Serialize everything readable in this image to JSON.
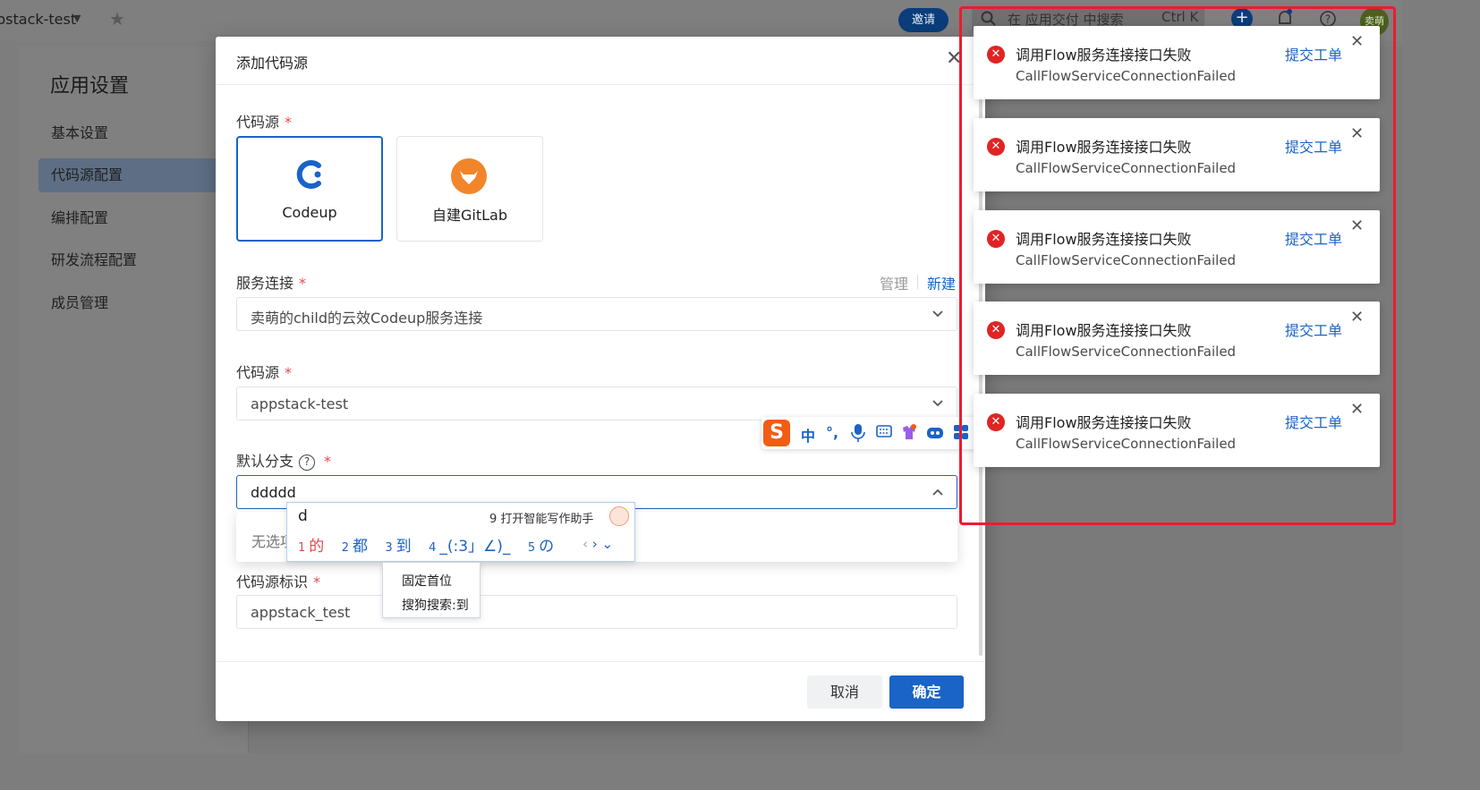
{
  "topbar": {
    "app_name": "pstack-test",
    "invite_label": "邀请",
    "search_placeholder": "在 应用交付 中搜索",
    "shortcut": "Ctrl K",
    "avatar_text": "卖萌"
  },
  "sidebar": {
    "title": "应用设置",
    "items": [
      {
        "label": "基本设置"
      },
      {
        "label": "代码源配置",
        "active": true
      },
      {
        "label": "编排配置"
      },
      {
        "label": "研发流程配置"
      },
      {
        "label": "成员管理"
      }
    ]
  },
  "modal": {
    "title": "添加代码源",
    "source_label": "代码源",
    "sources": [
      {
        "name": "Codeup",
        "selected": true
      },
      {
        "name": "自建GitLab",
        "selected": false
      }
    ],
    "service_label": "服务连接",
    "manage_link": "管理",
    "new_link": "新建",
    "service_value": "卖萌的child的云效Codeup服务连接",
    "repo_label": "代码源",
    "repo_value": "appstack-test",
    "branch_label": "默认分支",
    "branch_value": "ddddd",
    "dropdown_empty": "无选项",
    "identifier_label": "代码源标识",
    "identifier_value": "appstack_test",
    "required_mark": "*",
    "cancel_label": "取消",
    "ok_label": "确定"
  },
  "ime": {
    "typed": "d",
    "ai_hint": "9 打开智能写作助手",
    "candidates": [
      {
        "n": "1",
        "text": "的"
      },
      {
        "n": "2",
        "text": "都"
      },
      {
        "n": "3",
        "text": "到"
      },
      {
        "n": "4",
        "text": "_(:3」∠)_"
      },
      {
        "n": "5",
        "text": "の"
      }
    ],
    "menu": [
      "固定首位",
      "搜狗搜索:到"
    ],
    "toolbar_mode": "中",
    "toolbar_punct": "°,"
  },
  "notifications": [
    {
      "title": "调用Flow服务连接接口失败",
      "message": "CallFlowServiceConnectionFailed",
      "action": "提交工单"
    },
    {
      "title": "调用Flow服务连接接口失败",
      "message": "CallFlowServiceConnectionFailed",
      "action": "提交工单"
    },
    {
      "title": "调用Flow服务连接接口失败",
      "message": "CallFlowServiceConnectionFailed",
      "action": "提交工单"
    },
    {
      "title": "调用Flow服务连接接口失败",
      "message": "CallFlowServiceConnectionFailed",
      "action": "提交工单"
    },
    {
      "title": "调用Flow服务连接接口失败",
      "message": "CallFlowServiceConnectionFailed",
      "action": "提交工单"
    }
  ],
  "colors": {
    "accent": "#1a63c7",
    "error": "#e02424",
    "highlight_box": "#ec1b2e",
    "gitlab_orange": "#f2852a"
  }
}
